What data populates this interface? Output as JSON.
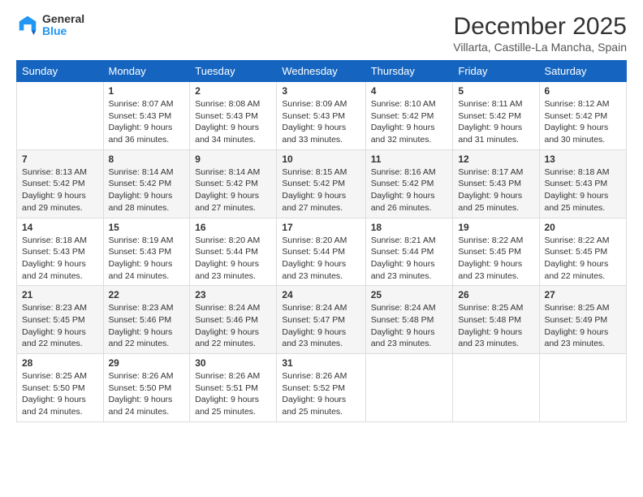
{
  "logo": {
    "general": "General",
    "blue": "Blue"
  },
  "title": "December 2025",
  "subtitle": "Villarta, Castille-La Mancha, Spain",
  "headers": [
    "Sunday",
    "Monday",
    "Tuesday",
    "Wednesday",
    "Thursday",
    "Friday",
    "Saturday"
  ],
  "weeks": [
    [
      {
        "day": "",
        "info": ""
      },
      {
        "day": "1",
        "info": "Sunrise: 8:07 AM\nSunset: 5:43 PM\nDaylight: 9 hours\nand 36 minutes."
      },
      {
        "day": "2",
        "info": "Sunrise: 8:08 AM\nSunset: 5:43 PM\nDaylight: 9 hours\nand 34 minutes."
      },
      {
        "day": "3",
        "info": "Sunrise: 8:09 AM\nSunset: 5:43 PM\nDaylight: 9 hours\nand 33 minutes."
      },
      {
        "day": "4",
        "info": "Sunrise: 8:10 AM\nSunset: 5:42 PM\nDaylight: 9 hours\nand 32 minutes."
      },
      {
        "day": "5",
        "info": "Sunrise: 8:11 AM\nSunset: 5:42 PM\nDaylight: 9 hours\nand 31 minutes."
      },
      {
        "day": "6",
        "info": "Sunrise: 8:12 AM\nSunset: 5:42 PM\nDaylight: 9 hours\nand 30 minutes."
      }
    ],
    [
      {
        "day": "7",
        "info": "Sunrise: 8:13 AM\nSunset: 5:42 PM\nDaylight: 9 hours\nand 29 minutes."
      },
      {
        "day": "8",
        "info": "Sunrise: 8:14 AM\nSunset: 5:42 PM\nDaylight: 9 hours\nand 28 minutes."
      },
      {
        "day": "9",
        "info": "Sunrise: 8:14 AM\nSunset: 5:42 PM\nDaylight: 9 hours\nand 27 minutes."
      },
      {
        "day": "10",
        "info": "Sunrise: 8:15 AM\nSunset: 5:42 PM\nDaylight: 9 hours\nand 27 minutes."
      },
      {
        "day": "11",
        "info": "Sunrise: 8:16 AM\nSunset: 5:42 PM\nDaylight: 9 hours\nand 26 minutes."
      },
      {
        "day": "12",
        "info": "Sunrise: 8:17 AM\nSunset: 5:43 PM\nDaylight: 9 hours\nand 25 minutes."
      },
      {
        "day": "13",
        "info": "Sunrise: 8:18 AM\nSunset: 5:43 PM\nDaylight: 9 hours\nand 25 minutes."
      }
    ],
    [
      {
        "day": "14",
        "info": "Sunrise: 8:18 AM\nSunset: 5:43 PM\nDaylight: 9 hours\nand 24 minutes."
      },
      {
        "day": "15",
        "info": "Sunrise: 8:19 AM\nSunset: 5:43 PM\nDaylight: 9 hours\nand 24 minutes."
      },
      {
        "day": "16",
        "info": "Sunrise: 8:20 AM\nSunset: 5:44 PM\nDaylight: 9 hours\nand 23 minutes."
      },
      {
        "day": "17",
        "info": "Sunrise: 8:20 AM\nSunset: 5:44 PM\nDaylight: 9 hours\nand 23 minutes."
      },
      {
        "day": "18",
        "info": "Sunrise: 8:21 AM\nSunset: 5:44 PM\nDaylight: 9 hours\nand 23 minutes."
      },
      {
        "day": "19",
        "info": "Sunrise: 8:22 AM\nSunset: 5:45 PM\nDaylight: 9 hours\nand 23 minutes."
      },
      {
        "day": "20",
        "info": "Sunrise: 8:22 AM\nSunset: 5:45 PM\nDaylight: 9 hours\nand 22 minutes."
      }
    ],
    [
      {
        "day": "21",
        "info": "Sunrise: 8:23 AM\nSunset: 5:45 PM\nDaylight: 9 hours\nand 22 minutes."
      },
      {
        "day": "22",
        "info": "Sunrise: 8:23 AM\nSunset: 5:46 PM\nDaylight: 9 hours\nand 22 minutes."
      },
      {
        "day": "23",
        "info": "Sunrise: 8:24 AM\nSunset: 5:46 PM\nDaylight: 9 hours\nand 22 minutes."
      },
      {
        "day": "24",
        "info": "Sunrise: 8:24 AM\nSunset: 5:47 PM\nDaylight: 9 hours\nand 23 minutes."
      },
      {
        "day": "25",
        "info": "Sunrise: 8:24 AM\nSunset: 5:48 PM\nDaylight: 9 hours\nand 23 minutes."
      },
      {
        "day": "26",
        "info": "Sunrise: 8:25 AM\nSunset: 5:48 PM\nDaylight: 9 hours\nand 23 minutes."
      },
      {
        "day": "27",
        "info": "Sunrise: 8:25 AM\nSunset: 5:49 PM\nDaylight: 9 hours\nand 23 minutes."
      }
    ],
    [
      {
        "day": "28",
        "info": "Sunrise: 8:25 AM\nSunset: 5:50 PM\nDaylight: 9 hours\nand 24 minutes."
      },
      {
        "day": "29",
        "info": "Sunrise: 8:26 AM\nSunset: 5:50 PM\nDaylight: 9 hours\nand 24 minutes."
      },
      {
        "day": "30",
        "info": "Sunrise: 8:26 AM\nSunset: 5:51 PM\nDaylight: 9 hours\nand 25 minutes."
      },
      {
        "day": "31",
        "info": "Sunrise: 8:26 AM\nSunset: 5:52 PM\nDaylight: 9 hours\nand 25 minutes."
      },
      {
        "day": "",
        "info": ""
      },
      {
        "day": "",
        "info": ""
      },
      {
        "day": "",
        "info": ""
      }
    ]
  ]
}
